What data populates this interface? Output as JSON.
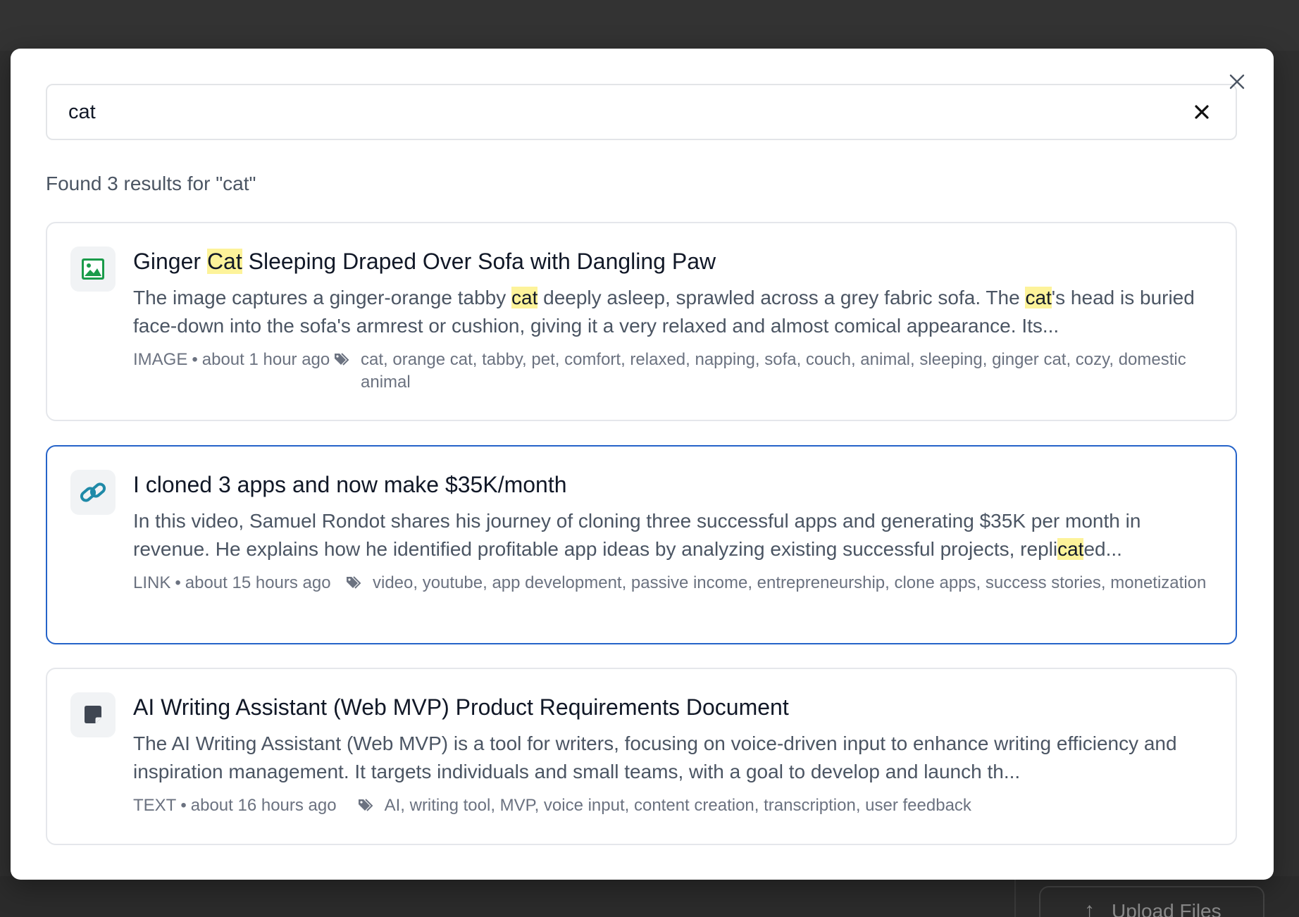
{
  "search": {
    "value": "cat",
    "placeholder": ""
  },
  "result_count": "Found 3 results for \"cat\"",
  "results": [
    {
      "type": "IMAGE",
      "icon": "image-icon",
      "icon_color": "#1a9b4a",
      "title_parts": [
        "Ginger ",
        "Cat",
        " Sleeping Draped Over Sofa with Dangling Paw"
      ],
      "desc_parts": [
        "The image captures a ginger-orange tabby ",
        "cat",
        " deeply asleep, sprawled across a grey fabric sofa. The ",
        "cat",
        "'s head is buried face-down into the sofa's armrest or cushion, giving it a very relaxed and almost comical appearance. Its..."
      ],
      "time": "about 1 hour ago",
      "tags": "cat, orange cat, tabby, pet, comfort, relaxed, napping, sofa, couch, animal, sleeping, ginger cat, cozy, domestic animal"
    },
    {
      "type": "LINK",
      "icon": "link-icon",
      "icon_color": "#1f8aa8",
      "title_parts": [
        "I cloned 3 apps and now make $35K/month"
      ],
      "desc_parts": [
        "In this video, Samuel Rondot shares his journey of cloning three successful apps and generating $35K per month in revenue. He explains how he identified profitable app ideas by analyzing existing successful projects, repli",
        "cat",
        "ed..."
      ],
      "time": "about 15 hours ago",
      "tags": "video, youtube, app development, passive income, entrepreneurship, clone apps, success stories, monetization"
    },
    {
      "type": "TEXT",
      "icon": "note-icon",
      "icon_color": "#3f4652",
      "title_parts": [
        "AI Writing Assistant (Web MVP) Product Requirements Document"
      ],
      "desc_parts": [
        "The AI Writing Assistant (Web MVP) is a tool for writers, focusing on voice-driven input to enhance writing efficiency and inspiration management. It targets individuals and small teams, with a goal to develop and launch th..."
      ],
      "time": "about 16 hours ago",
      "tags": "AI, writing tool, MVP, voice input, content creation, transcription, user feedback"
    }
  ],
  "background": {
    "upload_button_label": "Upload Files"
  },
  "colors": {
    "highlight": "#fdf39a",
    "selected_border": "#2563c9"
  }
}
